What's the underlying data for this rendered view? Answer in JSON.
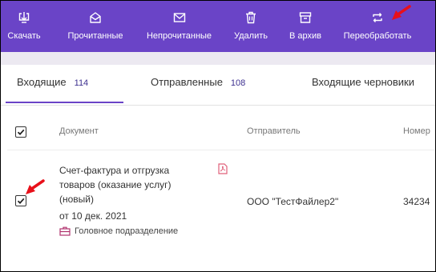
{
  "toolbar": {
    "buttons": [
      {
        "label": "Скачать",
        "icon": "download-icon"
      },
      {
        "label": "Прочитанные",
        "icon": "envelope-open-icon"
      },
      {
        "label": "Непрочитанные",
        "icon": "envelope-icon"
      },
      {
        "label": "Удалить",
        "icon": "trash-icon"
      },
      {
        "label": "В архив",
        "icon": "archive-icon"
      },
      {
        "label": "Переобработать",
        "icon": "reprocess-icon"
      }
    ],
    "background": "#6a44c7"
  },
  "tabs": [
    {
      "label": "Входящие",
      "count": "114"
    },
    {
      "label": "Отправленные",
      "count": "108"
    },
    {
      "label": "Входящие черновики",
      "count": ""
    }
  ],
  "table": {
    "headers": {
      "document": "Документ",
      "sender": "Отправитель",
      "number": "Номер"
    },
    "rows": [
      {
        "title": "Счет-фактура и отгрузка товаров (оказание услуг) (новый)",
        "date": "от 10 дек. 2021",
        "department": "Головное подразделение",
        "sender": "ООО \"ТестФайлер2\"",
        "number": "34234",
        "checked": true
      }
    ]
  },
  "colors": {
    "accent": "#6a44c7",
    "arrow": "#e8101a",
    "pdf_icon": "#e0607a"
  }
}
